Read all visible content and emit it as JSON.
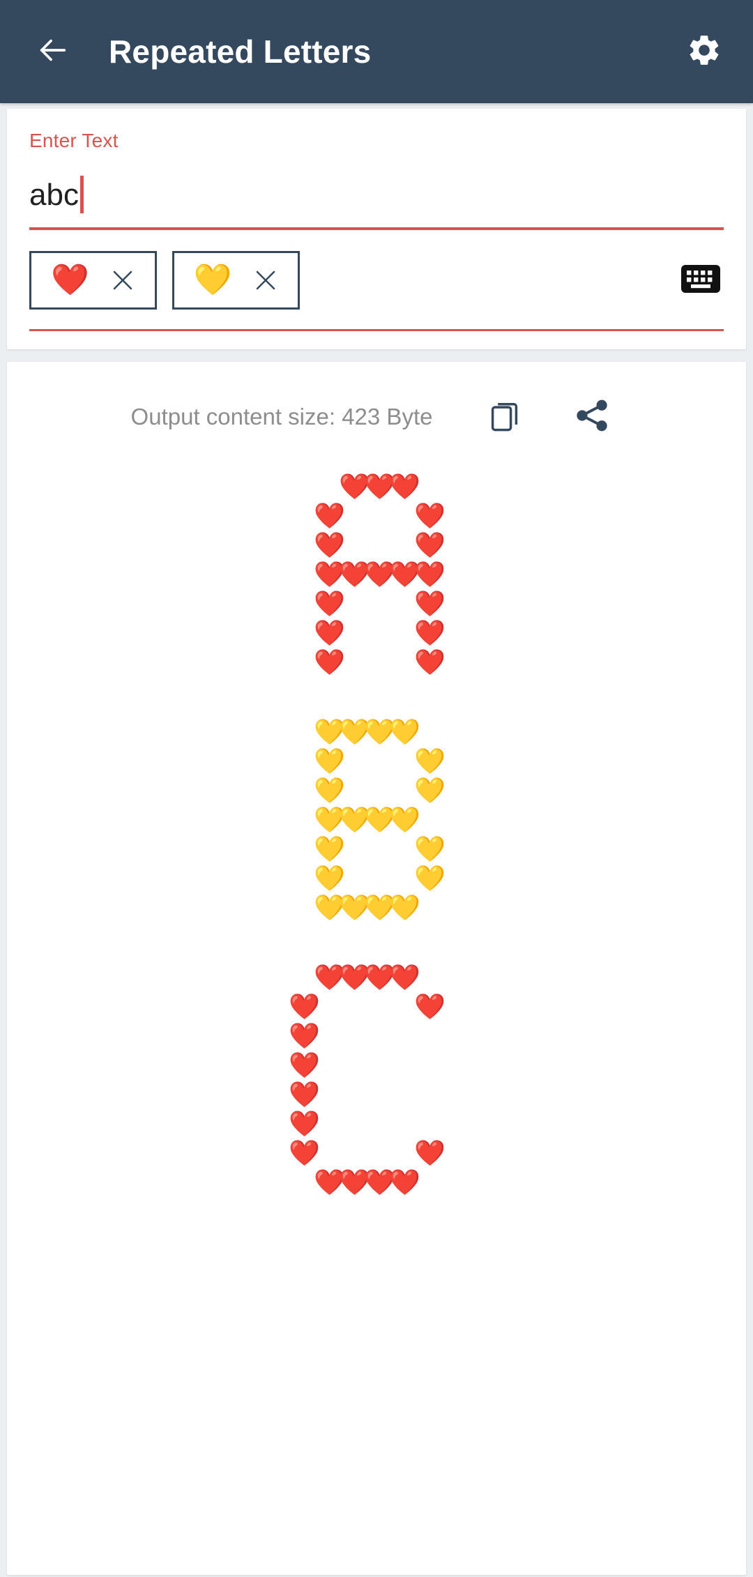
{
  "appbar": {
    "back_icon": "arrow-left-icon",
    "title": "Repeated Letters",
    "settings_icon": "gear-icon",
    "background_color": "#34495e",
    "title_color": "#ffffff"
  },
  "input_card": {
    "label": "Enter Text",
    "label_color": "#d9534f",
    "value": "abc",
    "placeholder": "Enter Text",
    "underline_color": "#d9534f",
    "keyboard_icon": "keyboard-icon",
    "chips": [
      {
        "emoji": "❤️",
        "name": "red-heart",
        "remove_icon": "close-icon",
        "border_color": "#34495e"
      },
      {
        "emoji": "💛",
        "name": "yellow-heart",
        "remove_icon": "close-icon",
        "border_color": "#34495e"
      }
    ]
  },
  "output_card": {
    "size_label": "Output content size: 423 Byte",
    "size_label_color": "#8d8d8d",
    "copy_icon": "copy-icon",
    "share_icon": "share-icon",
    "letters": [
      {
        "char": "A",
        "emoji": "❤️",
        "color": "#d63031",
        "cols": 7,
        "grid": [
          [
            0,
            0,
            1,
            1,
            1,
            0,
            0
          ],
          [
            0,
            1,
            0,
            0,
            0,
            1,
            0
          ],
          [
            0,
            1,
            0,
            0,
            0,
            1,
            0
          ],
          [
            0,
            1,
            1,
            1,
            1,
            1,
            0
          ],
          [
            0,
            1,
            0,
            0,
            0,
            1,
            0
          ],
          [
            0,
            1,
            0,
            0,
            0,
            1,
            0
          ],
          [
            0,
            1,
            0,
            0,
            0,
            1,
            0
          ]
        ]
      },
      {
        "char": "B",
        "emoji": "💛",
        "color": "#f0c419",
        "cols": 7,
        "grid": [
          [
            0,
            1,
            1,
            1,
            1,
            0,
            0
          ],
          [
            0,
            1,
            0,
            0,
            0,
            1,
            0
          ],
          [
            0,
            1,
            0,
            0,
            0,
            1,
            0
          ],
          [
            0,
            1,
            1,
            1,
            1,
            0,
            0
          ],
          [
            0,
            1,
            0,
            0,
            0,
            1,
            0
          ],
          [
            0,
            1,
            0,
            0,
            0,
            1,
            0
          ],
          [
            0,
            1,
            1,
            1,
            1,
            0,
            0
          ]
        ]
      },
      {
        "char": "C",
        "emoji": "❤️",
        "color": "#d63031",
        "cols": 7,
        "grid": [
          [
            0,
            1,
            1,
            1,
            1,
            0,
            0
          ],
          [
            1,
            0,
            0,
            0,
            0,
            1,
            0
          ],
          [
            1,
            0,
            0,
            0,
            0,
            0,
            0
          ],
          [
            1,
            0,
            0,
            0,
            0,
            0,
            0
          ],
          [
            1,
            0,
            0,
            0,
            0,
            0,
            0
          ],
          [
            1,
            0,
            0,
            0,
            0,
            0,
            0
          ],
          [
            1,
            0,
            0,
            0,
            0,
            1,
            0
          ],
          [
            0,
            1,
            1,
            1,
            1,
            0,
            0
          ]
        ]
      }
    ]
  }
}
